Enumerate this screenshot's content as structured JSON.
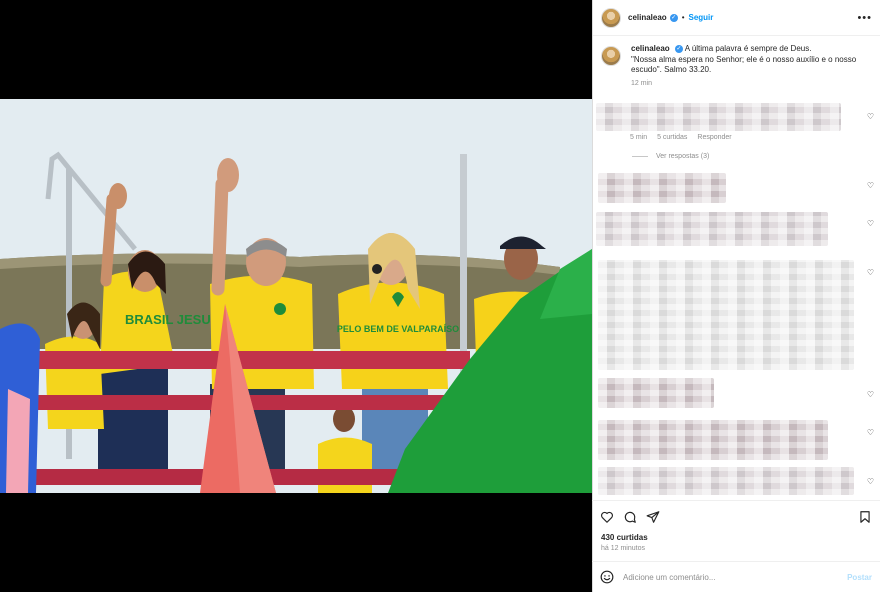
{
  "header": {
    "username": "celinaleao",
    "follow_label": "Seguir",
    "more_icon": "more-horizontal-icon"
  },
  "caption": {
    "username": "celinaleao",
    "text_line1": "A última palavra é sempre de Deus.",
    "text_line2": "\"Nossa alma espera no Senhor; ele é o nosso auxílio e o nosso",
    "text_line3": "escudo\". Salmo 33.20.",
    "time": "12 min"
  },
  "comment": {
    "time": "5 min",
    "likes": "5 curtidas",
    "reply_label": "Responder",
    "view_replies": "Ver respostas (3)"
  },
  "photo": {
    "shirt_text_left": "BRASIL JESUS",
    "shirt_text_center": "PELO BEM DE VALPARAÍSO"
  },
  "actions": {
    "like_icon": "heart-icon",
    "comment_icon": "comment-icon",
    "share_icon": "share-icon",
    "save_icon": "bookmark-icon"
  },
  "likes_count": "430 curtidas",
  "posted_ago": "há 12 minutos",
  "composer": {
    "placeholder": "Adicione um comentário...",
    "post_label": "Postar",
    "emoji_icon": "emoji-icon"
  },
  "colors": {
    "accent": "#0095f6",
    "brand_green": "#1e9e3a",
    "brand_yellow": "#f6d21a",
    "rail_red": "#c2324a"
  }
}
